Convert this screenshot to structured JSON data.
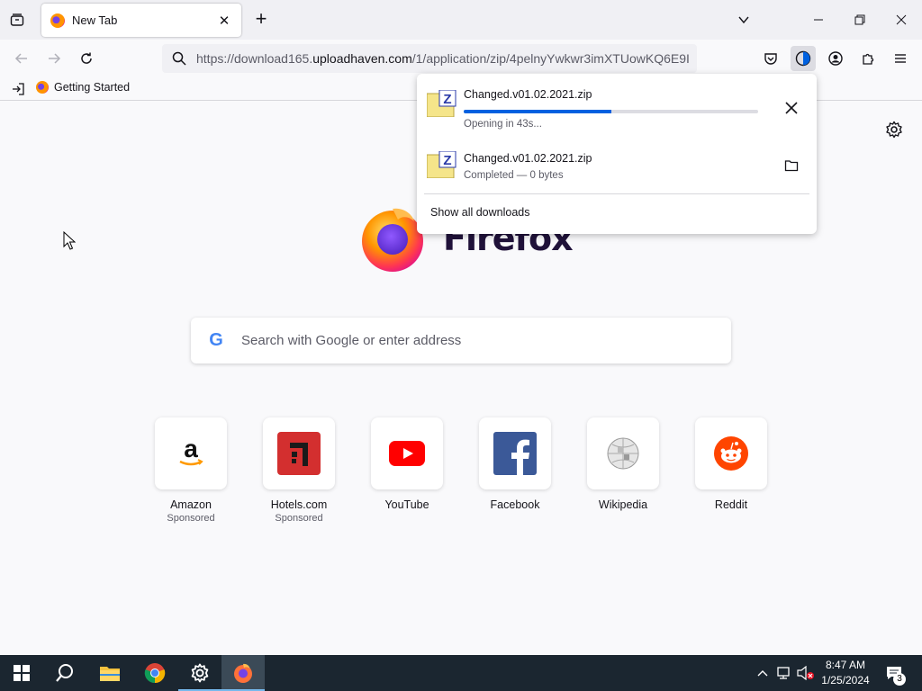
{
  "browser": {
    "tab": {
      "title": "New Tab"
    },
    "url": {
      "prefix": "https://download165.",
      "domain": "uploadhaven.com",
      "path": "/1/application/zip/4pelnyYwkwr3imXTUowKQ6E9I"
    },
    "bookmarks": [
      {
        "label": "Getting Started"
      }
    ]
  },
  "newtab": {
    "wordmark": "Firefox",
    "search_placeholder": "Search with Google or enter address",
    "google_glyph": "G",
    "shortcuts": [
      {
        "label": "Amazon",
        "sponsor": "Sponsored",
        "icon": "amazon-icon"
      },
      {
        "label": "Hotels.com",
        "sponsor": "Sponsored",
        "icon": "hotels-icon"
      },
      {
        "label": "YouTube",
        "sponsor": "",
        "icon": "youtube-icon"
      },
      {
        "label": "Facebook",
        "sponsor": "",
        "icon": "facebook-icon"
      },
      {
        "label": "Wikipedia",
        "sponsor": "",
        "icon": "wikipedia-icon"
      },
      {
        "label": "Reddit",
        "sponsor": "",
        "icon": "reddit-icon"
      }
    ]
  },
  "downloads": {
    "items": [
      {
        "name": "Changed.v01.02.2021.zip",
        "status": "Opening in 43s...",
        "progress": 0.5,
        "action": "cancel"
      },
      {
        "name": "Changed.v01.02.2021.zip",
        "status": "Completed — 0 bytes",
        "action": "show-in-folder"
      }
    ],
    "show_all": "Show all downloads"
  },
  "taskbar": {
    "time": "8:47 AM",
    "date": "1/25/2024",
    "notification_count": "3",
    "apps": [
      "start-icon",
      "search-icon",
      "file-explorer-icon",
      "chrome-icon",
      "settings-icon",
      "firefox-icon"
    ]
  },
  "colors": {
    "accent": "#0061e0",
    "taskbar": "#1b2630"
  }
}
